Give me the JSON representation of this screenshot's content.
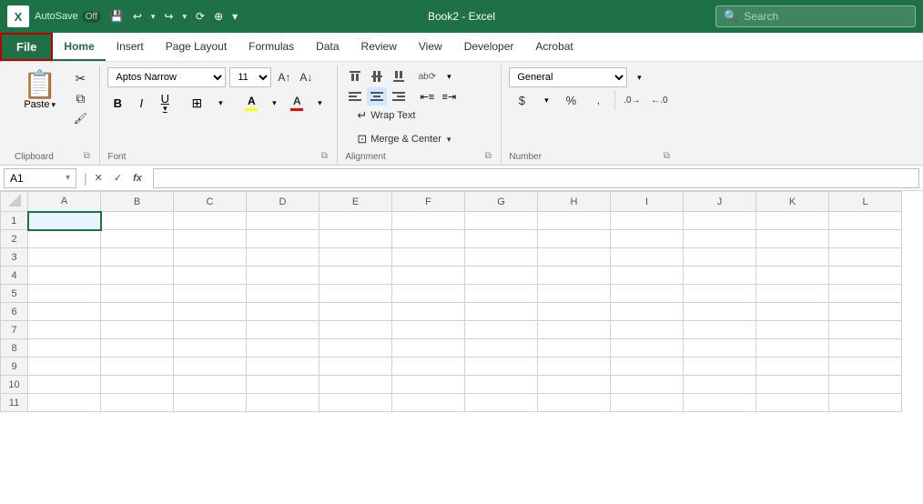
{
  "titleBar": {
    "appIcon": "X",
    "autoSaveLabel": "AutoSave",
    "autoSaveState": "Off",
    "undoLabel": "↩",
    "redoLabel": "↪",
    "saveLabel": "💾",
    "title": "Book2 - Excel",
    "searchPlaceholder": "Search",
    "toolbarIcons": [
      "💾",
      "↩",
      "↪",
      "⟳",
      "⊕"
    ]
  },
  "menuBar": {
    "items": [
      {
        "label": "File",
        "active": false,
        "file": true
      },
      {
        "label": "Home",
        "active": true
      },
      {
        "label": "Insert",
        "active": false
      },
      {
        "label": "Page Layout",
        "active": false
      },
      {
        "label": "Formulas",
        "active": false
      },
      {
        "label": "Data",
        "active": false
      },
      {
        "label": "Review",
        "active": false
      },
      {
        "label": "View",
        "active": false
      },
      {
        "label": "Developer",
        "active": false
      },
      {
        "label": "Acrobat",
        "active": false
      }
    ]
  },
  "ribbon": {
    "clipboard": {
      "pasteLabel": "Paste",
      "cutLabel": "Cut",
      "copyLabel": "Copy",
      "formatPainterLabel": "Format Painter",
      "groupLabel": "Clipboard"
    },
    "font": {
      "fontName": "Aptos Narrow",
      "fontSize": "11",
      "boldLabel": "B",
      "italicLabel": "I",
      "underlineLabel": "U",
      "borderLabel": "⊞",
      "fillLabel": "A",
      "fontColorLabel": "A",
      "groupLabel": "Font"
    },
    "alignment": {
      "alignTopLabel": "⊤",
      "alignMiddleLabel": "≡",
      "alignBottomLabel": "⊥",
      "alignLeftLabel": "≡",
      "alignCenterLabel": "≡",
      "alignRightLabel": "≡",
      "decIndentLabel": "←≡",
      "incIndentLabel": "≡→",
      "orientationLabel": "ab",
      "wrapTextLabel": "Wrap Text",
      "mergeCenterLabel": "Merge & Center",
      "groupLabel": "Alignment"
    },
    "number": {
      "formatLabel": "General",
      "dollarLabel": "$",
      "percentLabel": "%",
      "commaLabel": ",",
      "decDecLabel": ".00→0",
      "decIncLabel": ".0←",
      "groupLabel": "Number"
    }
  },
  "formulaBar": {
    "cellRef": "A1",
    "cancelLabel": "✕",
    "confirmLabel": "✓",
    "fxLabel": "fx",
    "formula": ""
  },
  "sheet": {
    "columns": [
      "A",
      "B",
      "C",
      "D",
      "E",
      "F",
      "G",
      "H",
      "I",
      "J",
      "K",
      "L"
    ],
    "rows": [
      1,
      2,
      3,
      4,
      5,
      6,
      7,
      8,
      9,
      10,
      11
    ],
    "selectedCell": "A1"
  }
}
